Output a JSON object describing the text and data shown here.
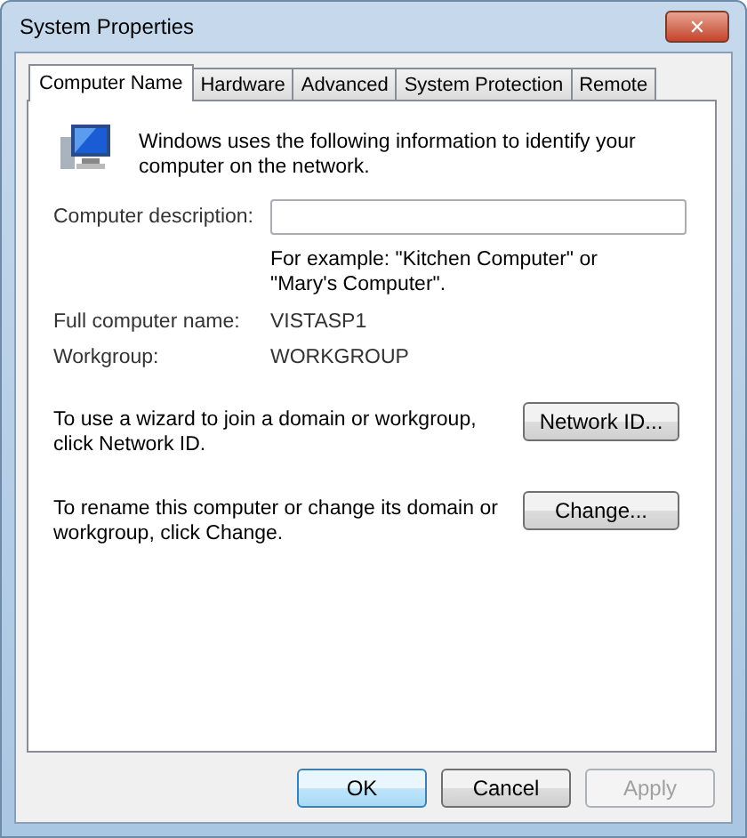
{
  "window": {
    "title": "System Properties",
    "close": "✕"
  },
  "tabs": [
    {
      "label": "Computer Name",
      "selected": true
    },
    {
      "label": "Hardware",
      "selected": false
    },
    {
      "label": "Advanced",
      "selected": false
    },
    {
      "label": "System Protection",
      "selected": false
    },
    {
      "label": "Remote",
      "selected": false
    }
  ],
  "intro": "Windows uses the following information to identify your computer on the network.",
  "description": {
    "label": "Computer description:",
    "hint": "For example: \"Kitchen Computer\" or \"Mary's Computer\"."
  },
  "info_rows": [
    {
      "label": "Full computer name:",
      "value": "VISTASP1"
    },
    {
      "label": "Workgroup:",
      "value": "WORKGROUP"
    }
  ],
  "actions": [
    {
      "text": "To use a wizard to join a domain or workgroup, click Network ID.",
      "button": "Network ID..."
    },
    {
      "text": "To rename this computer or change its domain or workgroup, click Change.",
      "button": "Change..."
    }
  ],
  "buttons": [
    {
      "label": "OK",
      "default": true,
      "disabled": false
    },
    {
      "label": "Cancel",
      "default": false,
      "disabled": false
    },
    {
      "label": "Apply",
      "default": false,
      "disabled": true
    }
  ]
}
